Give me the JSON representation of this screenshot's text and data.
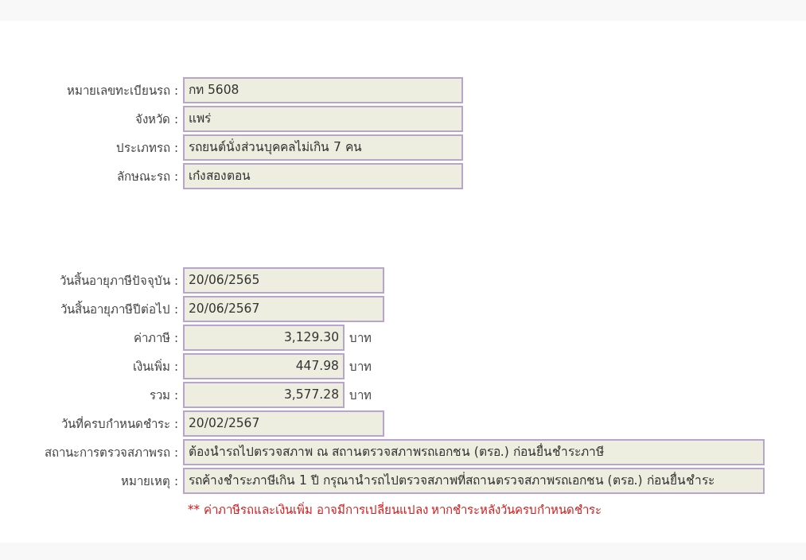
{
  "vehicle": [
    {
      "label": "หมายเลขทะเบียนรถ :",
      "value": "กท 5608",
      "kind": "text"
    },
    {
      "label": "จังหวัด :",
      "value": "แพร่",
      "kind": "text"
    },
    {
      "label": "ประเภทรถ :",
      "value": "รถยนต์นั่งส่วนบุคคลไม่เกิน 7 คน",
      "kind": "text"
    },
    {
      "label": "ลักษณะรถ :",
      "value": "เก๋งสองตอน",
      "kind": "text"
    }
  ],
  "tax": [
    {
      "label": "วันสิ้นอายุภาษีปัจจุบัน :",
      "value": "20/06/2565",
      "kind": "date"
    },
    {
      "label": "วันสิ้นอายุภาษีปีต่อไป :",
      "value": "20/06/2567",
      "kind": "date"
    },
    {
      "label": "ค่าภาษี :",
      "value": "3,129.30",
      "kind": "money",
      "unit": "บาท"
    },
    {
      "label": "เงินเพิ่ม :",
      "value": "447.98",
      "kind": "money",
      "unit": "บาท"
    },
    {
      "label": "รวม :",
      "value": "3,577.28",
      "kind": "money",
      "unit": "บาท"
    },
    {
      "label": "วันที่ครบกำหนดชำระ :",
      "value": "20/02/2567",
      "kind": "date"
    },
    {
      "label": "สถานะการตรวจสภาพรถ :",
      "value": "ต้องนำรถไปตรวจสภาพ ณ สถานตรวจสภาพรถเอกชน (ตรอ.) ก่อนยื่นชำระภาษี",
      "kind": "wide"
    },
    {
      "label": "หมายเหตุ :",
      "value": "รถค้างชำระภาษีเกิน 1 ปี กรุณานำรถไปตรวจสภาพที่สถานตรวจสภาพรถเอกชน (ตรอ.) ก่อนยื่นชำระ",
      "kind": "wide"
    }
  ],
  "warning": "** ค่าภาษีรถและเงินเพิ่ม อาจมีการเปลี่ยนแปลง หากชำระหลังวันครบกำหนดชำระ"
}
